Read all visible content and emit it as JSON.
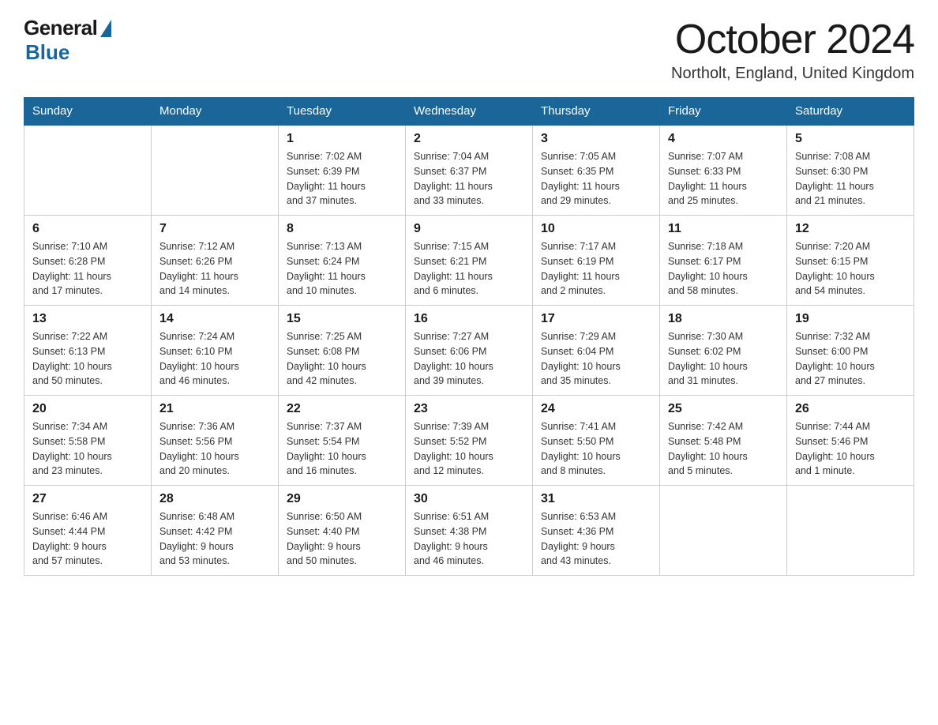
{
  "header": {
    "logo_general": "General",
    "logo_blue": "Blue",
    "title": "October 2024",
    "subtitle": "Northolt, England, United Kingdom"
  },
  "weekdays": [
    "Sunday",
    "Monday",
    "Tuesday",
    "Wednesday",
    "Thursday",
    "Friday",
    "Saturday"
  ],
  "weeks": [
    [
      {
        "day": "",
        "info": ""
      },
      {
        "day": "",
        "info": ""
      },
      {
        "day": "1",
        "info": "Sunrise: 7:02 AM\nSunset: 6:39 PM\nDaylight: 11 hours\nand 37 minutes."
      },
      {
        "day": "2",
        "info": "Sunrise: 7:04 AM\nSunset: 6:37 PM\nDaylight: 11 hours\nand 33 minutes."
      },
      {
        "day": "3",
        "info": "Sunrise: 7:05 AM\nSunset: 6:35 PM\nDaylight: 11 hours\nand 29 minutes."
      },
      {
        "day": "4",
        "info": "Sunrise: 7:07 AM\nSunset: 6:33 PM\nDaylight: 11 hours\nand 25 minutes."
      },
      {
        "day": "5",
        "info": "Sunrise: 7:08 AM\nSunset: 6:30 PM\nDaylight: 11 hours\nand 21 minutes."
      }
    ],
    [
      {
        "day": "6",
        "info": "Sunrise: 7:10 AM\nSunset: 6:28 PM\nDaylight: 11 hours\nand 17 minutes."
      },
      {
        "day": "7",
        "info": "Sunrise: 7:12 AM\nSunset: 6:26 PM\nDaylight: 11 hours\nand 14 minutes."
      },
      {
        "day": "8",
        "info": "Sunrise: 7:13 AM\nSunset: 6:24 PM\nDaylight: 11 hours\nand 10 minutes."
      },
      {
        "day": "9",
        "info": "Sunrise: 7:15 AM\nSunset: 6:21 PM\nDaylight: 11 hours\nand 6 minutes."
      },
      {
        "day": "10",
        "info": "Sunrise: 7:17 AM\nSunset: 6:19 PM\nDaylight: 11 hours\nand 2 minutes."
      },
      {
        "day": "11",
        "info": "Sunrise: 7:18 AM\nSunset: 6:17 PM\nDaylight: 10 hours\nand 58 minutes."
      },
      {
        "day": "12",
        "info": "Sunrise: 7:20 AM\nSunset: 6:15 PM\nDaylight: 10 hours\nand 54 minutes."
      }
    ],
    [
      {
        "day": "13",
        "info": "Sunrise: 7:22 AM\nSunset: 6:13 PM\nDaylight: 10 hours\nand 50 minutes."
      },
      {
        "day": "14",
        "info": "Sunrise: 7:24 AM\nSunset: 6:10 PM\nDaylight: 10 hours\nand 46 minutes."
      },
      {
        "day": "15",
        "info": "Sunrise: 7:25 AM\nSunset: 6:08 PM\nDaylight: 10 hours\nand 42 minutes."
      },
      {
        "day": "16",
        "info": "Sunrise: 7:27 AM\nSunset: 6:06 PM\nDaylight: 10 hours\nand 39 minutes."
      },
      {
        "day": "17",
        "info": "Sunrise: 7:29 AM\nSunset: 6:04 PM\nDaylight: 10 hours\nand 35 minutes."
      },
      {
        "day": "18",
        "info": "Sunrise: 7:30 AM\nSunset: 6:02 PM\nDaylight: 10 hours\nand 31 minutes."
      },
      {
        "day": "19",
        "info": "Sunrise: 7:32 AM\nSunset: 6:00 PM\nDaylight: 10 hours\nand 27 minutes."
      }
    ],
    [
      {
        "day": "20",
        "info": "Sunrise: 7:34 AM\nSunset: 5:58 PM\nDaylight: 10 hours\nand 23 minutes."
      },
      {
        "day": "21",
        "info": "Sunrise: 7:36 AM\nSunset: 5:56 PM\nDaylight: 10 hours\nand 20 minutes."
      },
      {
        "day": "22",
        "info": "Sunrise: 7:37 AM\nSunset: 5:54 PM\nDaylight: 10 hours\nand 16 minutes."
      },
      {
        "day": "23",
        "info": "Sunrise: 7:39 AM\nSunset: 5:52 PM\nDaylight: 10 hours\nand 12 minutes."
      },
      {
        "day": "24",
        "info": "Sunrise: 7:41 AM\nSunset: 5:50 PM\nDaylight: 10 hours\nand 8 minutes."
      },
      {
        "day": "25",
        "info": "Sunrise: 7:42 AM\nSunset: 5:48 PM\nDaylight: 10 hours\nand 5 minutes."
      },
      {
        "day": "26",
        "info": "Sunrise: 7:44 AM\nSunset: 5:46 PM\nDaylight: 10 hours\nand 1 minute."
      }
    ],
    [
      {
        "day": "27",
        "info": "Sunrise: 6:46 AM\nSunset: 4:44 PM\nDaylight: 9 hours\nand 57 minutes."
      },
      {
        "day": "28",
        "info": "Sunrise: 6:48 AM\nSunset: 4:42 PM\nDaylight: 9 hours\nand 53 minutes."
      },
      {
        "day": "29",
        "info": "Sunrise: 6:50 AM\nSunset: 4:40 PM\nDaylight: 9 hours\nand 50 minutes."
      },
      {
        "day": "30",
        "info": "Sunrise: 6:51 AM\nSunset: 4:38 PM\nDaylight: 9 hours\nand 46 minutes."
      },
      {
        "day": "31",
        "info": "Sunrise: 6:53 AM\nSunset: 4:36 PM\nDaylight: 9 hours\nand 43 minutes."
      },
      {
        "day": "",
        "info": ""
      },
      {
        "day": "",
        "info": ""
      }
    ]
  ]
}
